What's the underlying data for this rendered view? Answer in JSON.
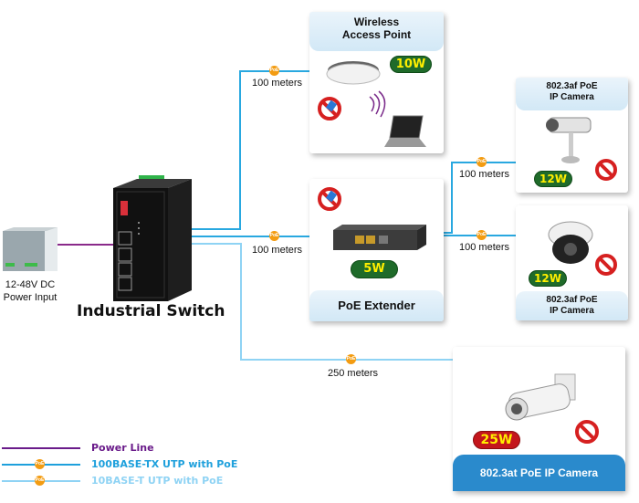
{
  "switch": {
    "label": "Industrial Switch"
  },
  "power_supply": {
    "label_line1": "12-48V DC",
    "label_line2": "Power Input"
  },
  "devices": {
    "wap": {
      "title_line1": "Wireless",
      "title_line2": "Access Point",
      "power": "10W"
    },
    "extender": {
      "title": "PoE Extender",
      "power": "5W"
    },
    "cam1": {
      "title_line1": "802.3af PoE",
      "title_line2": "IP Camera",
      "power": "12W"
    },
    "cam2": {
      "title_line1": "802.3af PoE",
      "title_line2": "IP Camera",
      "power": "12W"
    },
    "cam3": {
      "title": "802.3at PoE IP Camera",
      "power": "25W"
    }
  },
  "distances": {
    "to_wap": "100 meters",
    "to_extender": "100 meters",
    "ext_to_cam1": "100 meters",
    "ext_to_cam2": "100 meters",
    "to_cam3": "250 meters"
  },
  "poe_marker": "PoE",
  "legend": [
    {
      "label": "Power Line",
      "color": "#6a1b8a"
    },
    {
      "label": "100BASE-TX UTP with PoE",
      "color": "#1ea0dc"
    },
    {
      "label": "10BASE-T UTP with PoE",
      "color": "#8fd3f4"
    }
  ],
  "colors": {
    "tx_line": "#29a8e0",
    "t_line": "#8fd3f4",
    "power_line": "#8a2a8a",
    "poe_dot": "#f39c12"
  }
}
